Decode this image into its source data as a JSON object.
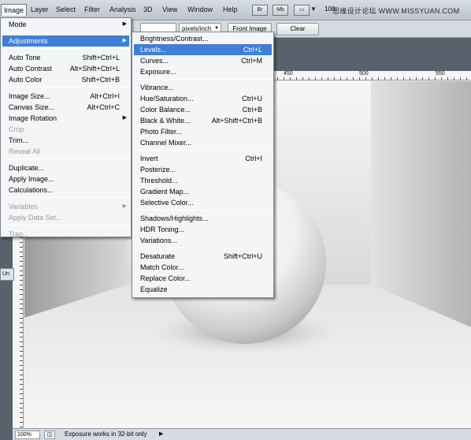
{
  "menubar": {
    "items": [
      "Image",
      "Layer",
      "Select",
      "Filter",
      "Analysis",
      "3D",
      "View",
      "Window",
      "Help"
    ],
    "bridge_label": "Br",
    "minibridge_label": "Mb",
    "zoom_partial": "100",
    "watermark": "思缘设计论坛 WWW.MISSYUAN.COM"
  },
  "options": {
    "unit_value": "pixels/inch",
    "front_image_label": "Front Image",
    "clear_label": "Clear"
  },
  "ruler": {
    "marks": [
      "450",
      "500",
      "550"
    ]
  },
  "document": {
    "tab_label": "Un"
  },
  "image_menu": [
    {
      "label": "Mode",
      "shortcut": "",
      "submenu": true
    },
    {
      "sep": true
    },
    {
      "label": "Adjustments",
      "shortcut": "",
      "submenu": true,
      "highlight": true
    },
    {
      "sep": true
    },
    {
      "label": "Auto Tone",
      "shortcut": "Shift+Ctrl+L"
    },
    {
      "label": "Auto Contrast",
      "shortcut": "Alt+Shift+Ctrl+L"
    },
    {
      "label": "Auto Color",
      "shortcut": "Shift+Ctrl+B"
    },
    {
      "sep": true
    },
    {
      "label": "Image Size...",
      "shortcut": "Alt+Ctrl+I"
    },
    {
      "label": "Canvas Size...",
      "shortcut": "Alt+Ctrl+C"
    },
    {
      "label": "Image Rotation",
      "shortcut": "",
      "submenu": true
    },
    {
      "label": "Crop",
      "shortcut": "",
      "disabled": true
    },
    {
      "label": "Trim...",
      "shortcut": ""
    },
    {
      "label": "Reveal All",
      "shortcut": "",
      "disabled": true
    },
    {
      "sep": true
    },
    {
      "label": "Duplicate...",
      "shortcut": ""
    },
    {
      "label": "Apply Image...",
      "shortcut": ""
    },
    {
      "label": "Calculations...",
      "shortcut": ""
    },
    {
      "sep": true
    },
    {
      "label": "Variables",
      "shortcut": "",
      "submenu": true,
      "disabled": true
    },
    {
      "label": "Apply Data Set...",
      "shortcut": "",
      "disabled": true
    },
    {
      "sep": true
    },
    {
      "label": "Trap...",
      "shortcut": "",
      "disabled": true
    }
  ],
  "adjustments_menu": [
    {
      "label": "Brightness/Contrast...",
      "shortcut": ""
    },
    {
      "label": "Levels...",
      "shortcut": "Ctrl+L",
      "highlight": true
    },
    {
      "label": "Curves...",
      "shortcut": "Ctrl+M"
    },
    {
      "label": "Exposure...",
      "shortcut": ""
    },
    {
      "sep": true
    },
    {
      "label": "Vibrance...",
      "shortcut": ""
    },
    {
      "label": "Hue/Saturation...",
      "shortcut": "Ctrl+U"
    },
    {
      "label": "Color Balance...",
      "shortcut": "Ctrl+B"
    },
    {
      "label": "Black & White...",
      "shortcut": "Alt+Shift+Ctrl+B"
    },
    {
      "label": "Photo Filter...",
      "shortcut": ""
    },
    {
      "label": "Channel Mixer...",
      "shortcut": ""
    },
    {
      "sep": true
    },
    {
      "label": "Invert",
      "shortcut": "Ctrl+I"
    },
    {
      "label": "Posterize...",
      "shortcut": ""
    },
    {
      "label": "Threshold...",
      "shortcut": ""
    },
    {
      "label": "Gradient Map...",
      "shortcut": ""
    },
    {
      "label": "Selective Color...",
      "shortcut": ""
    },
    {
      "sep": true
    },
    {
      "label": "Shadows/Highlights...",
      "shortcut": ""
    },
    {
      "label": "HDR Toning...",
      "shortcut": ""
    },
    {
      "label": "Variations...",
      "shortcut": ""
    },
    {
      "sep": true
    },
    {
      "label": "Desaturate",
      "shortcut": "Shift+Ctrl+U"
    },
    {
      "label": "Match Color...",
      "shortcut": ""
    },
    {
      "label": "Replace Color...",
      "shortcut": ""
    },
    {
      "label": "Equalize",
      "shortcut": ""
    }
  ],
  "status": {
    "zoom": "100%",
    "text": "Exposure works in 32-bit only"
  }
}
